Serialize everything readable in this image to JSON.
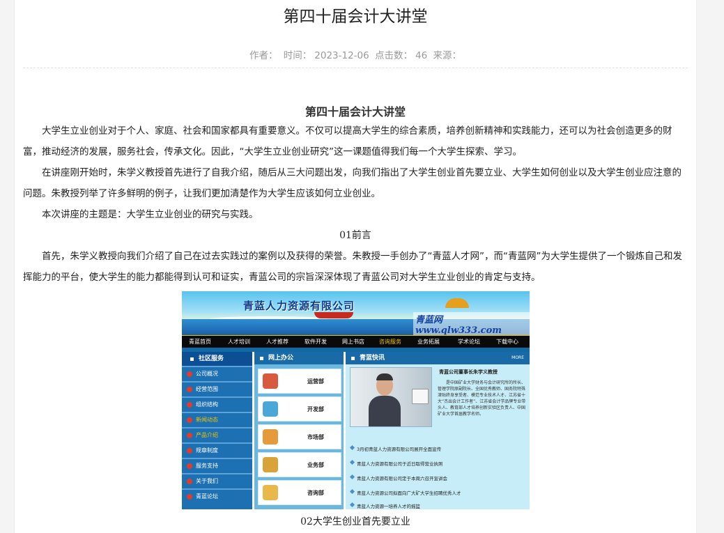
{
  "article": {
    "title": "第四十届会计大讲堂",
    "meta": {
      "author_label": "作者：",
      "time_label": "时间：",
      "time": "2023-12-06",
      "clicks_label": "点击数：",
      "clicks": "46",
      "source_label": "来源："
    },
    "subtitle": "第四十届会计大讲堂",
    "paragraphs": [
      "大学生立业创业对于个人、家庭、社会和国家都具有重要意义。不仅可以提高大学生的综合素质，培养创新精神和实践能力，还可以为社会创造更多的财富，推动经济的发展，服务社会，传承文化。因此，“大学生立业创业研究”这一课题值得我们每一个大学生探索、学习。",
      "在讲座刚开始时，朱学义教授首先进行了自我介绍，随后从三大问题出发，向我们指出了大学生创业首先要立业、大学生如何创业以及大学生创业应注意的问题。朱教授列举了许多鲜明的例子，让我们更加清楚作为大学生应该如何立业创业。",
      "本次讲座的主题是：大学生立业创业的研究与实践。",
      "首先，朱学义教授向我们介绍了自己在过去实践过的案例以及获得的荣誉。朱教授一手创办了“青蓝人才网”，而“青蓝网”为大学生提供了一个锻炼自己和发挥能力的平台，使大学生的能力都能得到认可和证实，青蓝公司的宗旨深深体现了青蓝公司对大学生立业创业的肯定与支持。"
    ],
    "section1": "01前言",
    "section2": "02大学生创业首先要立业"
  },
  "screenshot": {
    "company": "青蓝人力资源有限公司",
    "site": "青蓝网www.qlw333.com",
    "nav": [
      "青蓝首页",
      "人才培训",
      "人才推荐",
      "软件开发",
      "网上书店",
      "咨询服务",
      "业务拓展",
      "学术论坛",
      "下载中心"
    ],
    "left_header": "社区服务",
    "left_items": [
      "公司概况",
      "经营范围",
      "组织结构",
      "新闻动态",
      "产品介绍",
      "规章制度",
      "服务支持",
      "关于我们",
      "青蓝论坛"
    ],
    "mid_header": "网上办公",
    "mid_items": [
      "运营部",
      "开发部",
      "市场部",
      "业务部",
      "咨询部"
    ],
    "right_header": "青蓝快讯",
    "right_more": "MORE",
    "profile_title": "青蓝公司董事长朱学义教授",
    "profile_desc": "是中国矿业大学财务与会计研究所的所长、管理学院原副院长、全国优秀教师、国务院特殊津贴终身享受者、模范专业技术人才、江苏省十大“杰出会计工作者”、江苏省会计学品牌专业带头人、教育部人才培养创新实验区负责人、中国矿业大学首届教学名师。",
    "news": [
      "3月初青蓝人力资源有限公司展开全面宣传",
      "青蓝人力资源有限公司于近日取得营业执照",
      "青蓝人力资源有限公司定于本周六召开宣讲会",
      "青蓝人力资源公司拟面向广大矿大学生招聘优秀人才",
      "青蓝人力资源一培养人才的摇篮"
    ]
  }
}
